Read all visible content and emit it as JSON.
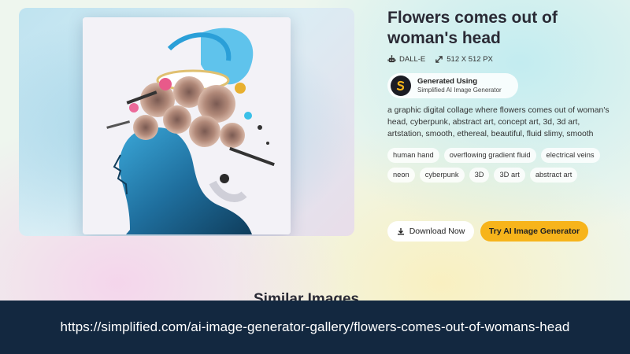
{
  "image": {
    "alt": "Flowers comes out of woman's head"
  },
  "details": {
    "title": "Flowers comes out of woman's head",
    "model": "DALL-E",
    "size": "512 X 512 PX",
    "generated_label": "Generated Using",
    "generator_name": "Simplified AI Image Generator",
    "description": "a graphic digital collage where flowers comes out of woman's head, cyberpunk, abstract art, concept art, 3d, 3d art, artstation, smooth, ethereal, beautiful, fluid slimy, smooth",
    "tags": [
      "human hand",
      "overflowing gradient fluid",
      "electrical veins",
      "neon",
      "cyberpunk",
      "3D",
      "3D art",
      "abstract art"
    ]
  },
  "actions": {
    "download_label": "Download Now",
    "try_label": "Try AI Image Generator"
  },
  "similar": {
    "heading": "Similar Images"
  },
  "url_bar": {
    "url": "https://simplified.com/ai-image-generator-gallery/flowers-comes-out-of-womans-head"
  },
  "colors": {
    "accent_button": "#f7b41b",
    "url_bar_bg": "#132840"
  }
}
